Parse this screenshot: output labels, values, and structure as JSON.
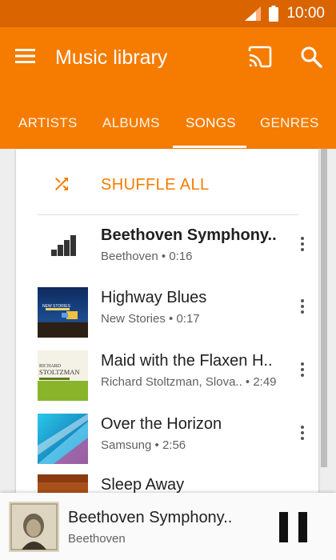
{
  "status_bar": {
    "time": "10:00",
    "icons": [
      "signal-icon",
      "battery-icon"
    ]
  },
  "app_bar": {
    "title": "Music library",
    "icons": [
      "menu-icon",
      "cast-icon",
      "search-icon"
    ],
    "accent": "#f57c00",
    "status_color": "#d96400"
  },
  "tabs": [
    {
      "label": "ARTISTS",
      "active": false
    },
    {
      "label": "ALBUMS",
      "active": false
    },
    {
      "label": "SONGS",
      "active": true
    },
    {
      "label": "GENRES",
      "active": false
    }
  ],
  "shuffle": {
    "label": "SHUFFLE ALL",
    "icon": "shuffle-icon"
  },
  "songs": [
    {
      "title": "Beethoven Symphony..",
      "subtitle": "Beethoven • 0:16",
      "now_playing": true,
      "art": "equalizer-icon"
    },
    {
      "title": "Highway Blues",
      "subtitle": "New Stories • 0:17",
      "now_playing": false,
      "art": "album-art"
    },
    {
      "title": "Maid with the Flaxen H..",
      "subtitle": "Richard Stoltzman, Slova..  • 2:49",
      "now_playing": false,
      "art": "album-art"
    },
    {
      "title": "Over the Horizon",
      "subtitle": "Samsung • 2:56",
      "now_playing": false,
      "art": "album-art"
    },
    {
      "title": "Sleep Away",
      "subtitle": "",
      "now_playing": false,
      "art": "album-art"
    }
  ],
  "art_text": {
    "highway": "NEW STORIES",
    "maid_top": "RICHARD",
    "maid_name": "STOLTZMAN"
  },
  "player": {
    "title": "Beethoven Symphony..",
    "artist": "Beethoven",
    "state": "playing",
    "control_icon": "pause-icon"
  }
}
